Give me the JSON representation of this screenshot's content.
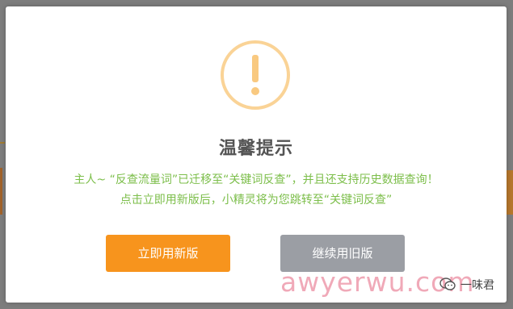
{
  "dialog": {
    "title": "温馨提示",
    "message_line1": "主人~ “反查流量词”已迁移至“关键词反查”，并且还支持历史数据查询！",
    "message_line2": "点击立即用新版后，小精灵将为您跳转至“关键词反查”",
    "primary_button": "立即用新版",
    "secondary_button": "继续用旧版",
    "icon": "warning-exclamation-icon"
  },
  "watermark": {
    "text": "awyerwu.com",
    "author": "一味君"
  },
  "colors": {
    "primary": "#f7941d",
    "secondary": "#9b9ea4",
    "message": "#7cbe4a",
    "icon": "#f9c980"
  }
}
